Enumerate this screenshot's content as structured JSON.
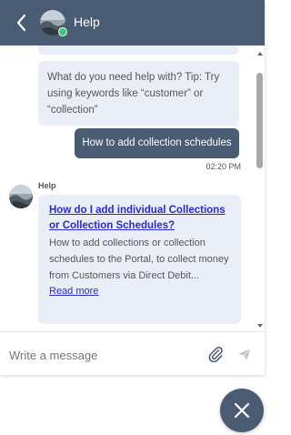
{
  "header": {
    "title": "Help",
    "status": "online",
    "back_icon": "chevron-left-icon"
  },
  "messages": {
    "bot_intro": "What do you need help with? Tip: Try using keywords like “customer” or “collection”",
    "user_query": "How to add collection schedules",
    "user_time": "02:20 PM",
    "bot_sender": "Help",
    "article": {
      "title": "How do I add individual Collections or Collection Schedules?",
      "snippet": "How to add collections or collection schedules to the Portal, to collect money from Customers via Direct Debit...",
      "link_label": "Read more"
    }
  },
  "composer": {
    "placeholder": "Write a message",
    "attach_icon": "paperclip-icon",
    "send_icon": "send-icon"
  },
  "fab": {
    "icon": "close-icon"
  },
  "colors": {
    "header": "#495c74",
    "bubble": "#eaeef7",
    "link": "#2a2acf",
    "online": "#3cc47c"
  }
}
